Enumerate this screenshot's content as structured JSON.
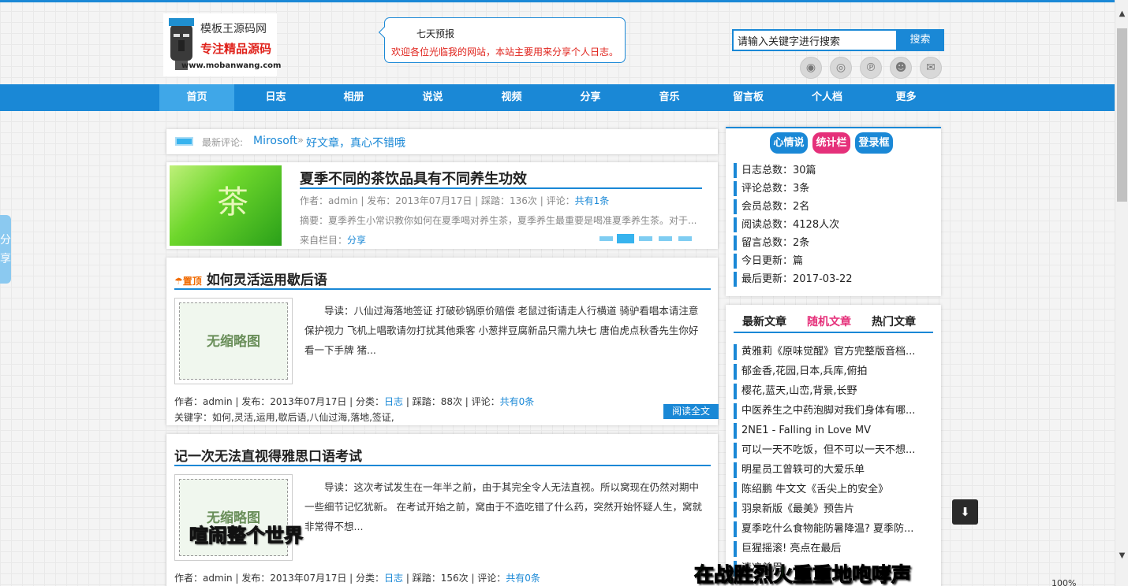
{
  "logo": {
    "name": "模板王源码网",
    "slogan": "专注精品源码",
    "url": "www.mobanwang.com"
  },
  "forecast": {
    "title": "七天预报",
    "message": "欢迎各位光临我的网站，本站主要用来分享个人日志。"
  },
  "search": {
    "value": "请输入关键字进行搜索",
    "button": "搜索"
  },
  "social_icons": [
    "rss-icon",
    "weibo-icon",
    "pinterest-icon",
    "qq-icon",
    "mail-icon"
  ],
  "nav": {
    "items": [
      "首页",
      "日志",
      "相册",
      "说说",
      "视频",
      "分享",
      "音乐",
      "留言板",
      "个人档",
      "更多"
    ],
    "active": "首页"
  },
  "latest_comment": {
    "label": "最新评论:",
    "user": "Mirosoft",
    "separator": "»",
    "text": "好文章，真心不错哦"
  },
  "slider": {
    "image_text": "茶",
    "title": "夏季不同的茶饮品具有不同养生功效",
    "meta_prefix": "作者：admin | 发布：2013年07月17日 | 踩踏：136次 | 评论：",
    "meta_comments": "共有1条",
    "summary": "摘要：夏季养生小常识教你如何在夏季喝对养生茶，夏季养生最重要是喝准夏季养生茶。对于...",
    "category_label": "来自栏目：",
    "category": "分享",
    "dots": 5,
    "active_dot": 2
  },
  "posts": [
    {
      "badge": "置顶",
      "title": "如何灵活运用歇后语",
      "thumb_text": "无缩略图",
      "excerpt": "导读：八仙过海落地签证 打破砂锅原价赔偿 老鼠过街请走人行横道 骑驴看唱本请注意保护视力 飞机上唱歌请勿打扰其他乘客 小葱拌豆腐新品只需九块七 唐伯虎点秋香先生你好看一下手牌 猪...",
      "meta_a": "作者：admin | 发布：2013年07月17日 | 分类：",
      "category": "日志",
      "meta_b": " | 踩踏：88次 | 评论：",
      "comments": "共有0条",
      "keywords": "关键字：如何,灵活,运用,歇后语,八仙过海,落地,签证,",
      "read_more": "阅读全文"
    },
    {
      "title": "记一次无法直视得雅思口语考试",
      "thumb_text": "无缩略图",
      "excerpt": "导读：这次考试发生在一年半之前，由于其完全令人无法直视。所以窝现在仍然对期中一些细节记忆犹新。 在考试开始之前，窝由于不造吃错了什么药，突然开始怀疑人生，窝就非常得不想...",
      "meta_a": "作者：admin | 发布：2013年07月17日 | 分类：",
      "category": "日志",
      "meta_b": " | 踩踏：156次 | 评论：",
      "comments": "共有0条"
    }
  ],
  "sidebar_tabs": [
    {
      "label": "心情说",
      "color": "#1a88d6"
    },
    {
      "label": "统计栏",
      "color": "#e5307a"
    },
    {
      "label": "登录框",
      "color": "#1a88d6"
    }
  ],
  "stats": [
    "日志总数：30篇",
    "评论总数：3条",
    "会员总数：2名",
    "阅读总数：4128人次",
    "留言总数：2条",
    "今日更新：篇",
    "最后更新：2017-03-22"
  ],
  "article_tabs": [
    "最新文章",
    "随机文章",
    "热门文章"
  ],
  "article_tab_active": "随机文章",
  "articles": [
    "黄雅莉《原味觉醒》官方完整版音档...",
    "郁金香,花园,日本,兵库,俯拍",
    "樱花,蓝天,山峦,背景,长野",
    "中医养生之中药泡脚对我们身体有哪...",
    "2NE1 - Falling in Love MV",
    "可以一天不吃饭，但不可以一天不想...",
    "明星员工曾轶可的大爱乐单",
    "陈绍鹏 牛文文《舌尖上的安全》",
    "羽泉新版《最美》预告片",
    "夏季吃什么食物能防暑降温? 夏季防...",
    "巨猩摇滚! 亮点在最后",
    "清凉美眉"
  ],
  "share_tab": "分享",
  "back_to_top": "arrow-down-icon",
  "status_zoom": "100%",
  "subtitles": {
    "left": "喧闹整个世界",
    "right_a": "在战胜烈火",
    "right_b": "重重地咆哮声"
  }
}
